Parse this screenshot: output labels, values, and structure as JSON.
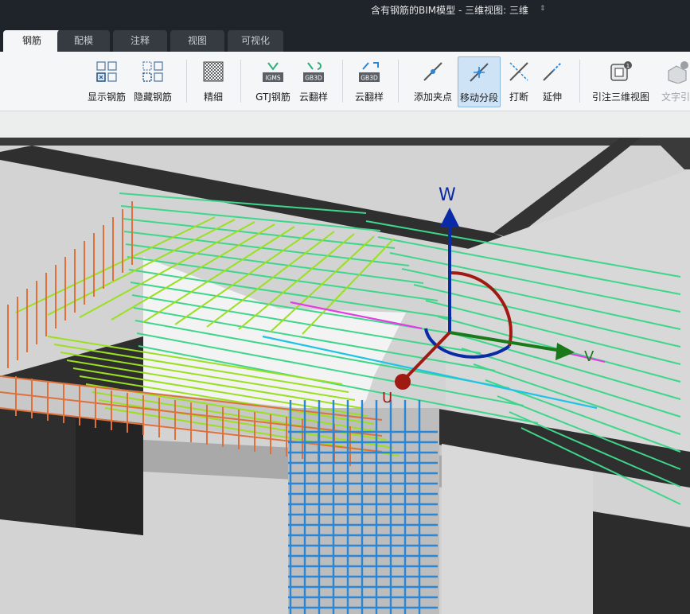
{
  "window": {
    "title": "含有钢筋的BIM模型 - 三维视图: 三维"
  },
  "tabs": [
    {
      "label": "钢筋",
      "active": true
    },
    {
      "label": "配模",
      "active": false
    },
    {
      "label": "注释",
      "active": false
    },
    {
      "label": "视图",
      "active": false
    },
    {
      "label": "可视化",
      "active": false
    }
  ],
  "ribbon": {
    "buttons": [
      {
        "label": "显示钢筋",
        "icon": "show-rebar-icon"
      },
      {
        "label": "隐藏钢筋",
        "icon": "hide-rebar-icon"
      },
      {
        "label": "精细",
        "icon": "fine-detail-icon"
      },
      {
        "label": "GTJ钢筋",
        "icon": "gtj-rebar-icon",
        "badge": "IGMS"
      },
      {
        "label": "云翻样",
        "icon": "cloud-detailing-icon",
        "badge": "GB3D"
      },
      {
        "label": "云翻样",
        "icon": "cloud-detailing-icon",
        "badge": "GB3D"
      },
      {
        "label": "添加夹点",
        "icon": "add-grip-icon"
      },
      {
        "label": "移动分段",
        "icon": "move-segment-icon",
        "selected": true
      },
      {
        "label": "打断",
        "icon": "break-icon"
      },
      {
        "label": "延伸",
        "icon": "extend-icon"
      },
      {
        "label": "引注三维视图",
        "icon": "annotate-3d-view-icon"
      },
      {
        "label": "文字引注",
        "icon": "text-annotation-icon",
        "disabled": true
      }
    ]
  },
  "gizmo": {
    "axis_w": "W",
    "axis_v": "V",
    "axis_u": "U"
  },
  "colors": {
    "titlebar": "#1f242b",
    "ribbon": "#f5f6f7",
    "accent_selected": "#cfe3f6",
    "rebar_green": "#3ed68a",
    "rebar_lime": "#9be01f",
    "rebar_orange": "#e0703a",
    "rebar_blue": "#2a86d6",
    "axis_blue": "#0a2aa6",
    "axis_green": "#1a7a1a",
    "axis_red": "#a01a12"
  }
}
